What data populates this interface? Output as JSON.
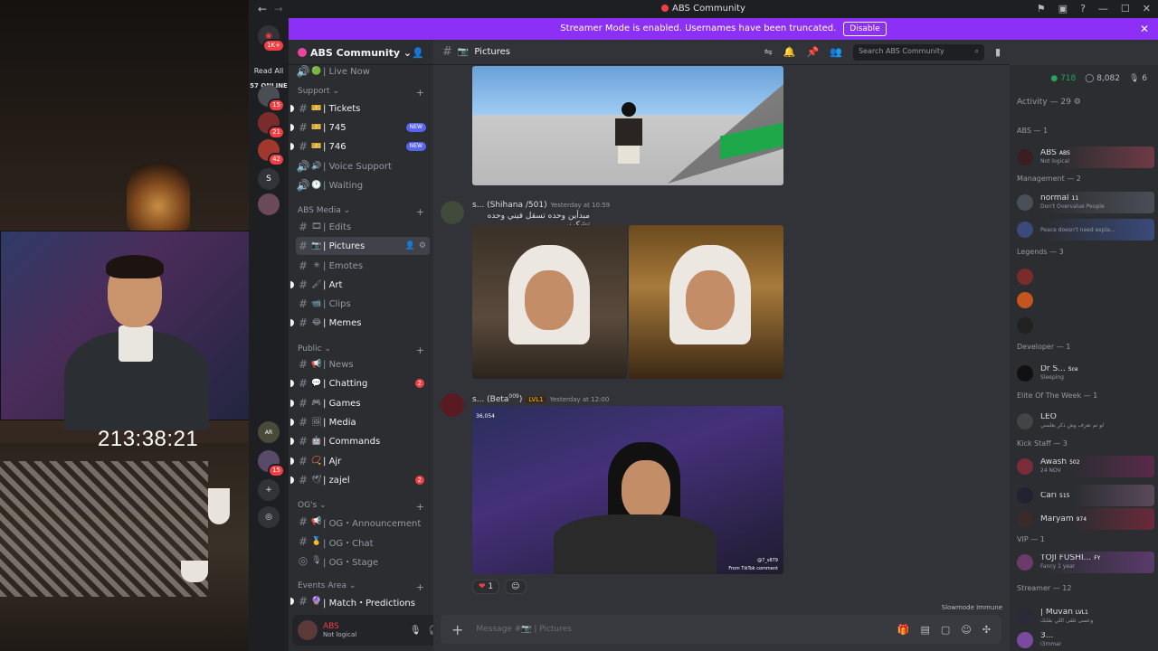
{
  "overlay": {
    "timer": "213:38:21"
  },
  "titlebar": {
    "title": "ABS Community",
    "back": "←",
    "forward": "→"
  },
  "guild_rail": {
    "read_all": "Read All",
    "online": "57 ONLINE",
    "badges": [
      "1K+",
      "15",
      "21",
      "42",
      "15"
    ],
    "server_letter": "S",
    "small_tag": "AR"
  },
  "banner": {
    "text": "Streamer Mode is enabled. Usernames have been truncated.",
    "button": "Disable",
    "close": "✕"
  },
  "server": {
    "name": "ABS Community"
  },
  "channels": [
    {
      "name": "Live Now",
      "emoji": "🟢",
      "type": "voice",
      "state": "normal"
    },
    {
      "category": "Support"
    },
    {
      "name": "Tickets",
      "emoji": "🎫",
      "type": "text",
      "state": "unread"
    },
    {
      "name": "745",
      "emoji": "🎫",
      "type": "text",
      "state": "unread",
      "badge": "NEW"
    },
    {
      "name": "746",
      "emoji": "🎫",
      "type": "text",
      "state": "unread",
      "badge": "NEW"
    },
    {
      "name": "Voice Support",
      "emoji": "🔊",
      "type": "voice",
      "state": "normal"
    },
    {
      "name": "Waiting",
      "emoji": "🕐",
      "type": "voice",
      "state": "normal"
    },
    {
      "category": "ABS Media"
    },
    {
      "name": "Edits",
      "emoji": "🎞",
      "type": "text",
      "state": "normal"
    },
    {
      "name": "Pictures",
      "emoji": "📷",
      "type": "text",
      "state": "active"
    },
    {
      "name": "Emotes",
      "emoji": "✳",
      "type": "text",
      "state": "normal"
    },
    {
      "name": "Art",
      "emoji": "🖌",
      "type": "text",
      "state": "unread"
    },
    {
      "name": "Clips",
      "emoji": "📹",
      "type": "text",
      "state": "normal"
    },
    {
      "name": "Memes",
      "emoji": "😂",
      "type": "text",
      "state": "unread"
    },
    {
      "category": "Public"
    },
    {
      "name": "News",
      "emoji": "📢",
      "type": "text",
      "state": "normal"
    },
    {
      "name": "Chatting",
      "emoji": "💬",
      "type": "text",
      "state": "unread",
      "count": "2"
    },
    {
      "name": "Games",
      "emoji": "🎮",
      "type": "text",
      "state": "unread"
    },
    {
      "name": "Media",
      "emoji": "🖼",
      "type": "text",
      "state": "unread"
    },
    {
      "name": "Commands",
      "emoji": "🤖",
      "type": "text",
      "state": "unread"
    },
    {
      "name": "Ajr",
      "emoji": "📿",
      "type": "text",
      "state": "unread"
    },
    {
      "name": "zajel",
      "emoji": "🕊",
      "type": "text",
      "state": "unread",
      "count": "2"
    },
    {
      "category": "OG's"
    },
    {
      "name": "OG・Announcement",
      "emoji": "📢",
      "type": "text",
      "state": "normal"
    },
    {
      "name": "OG・Chat",
      "emoji": "🥇",
      "type": "text",
      "state": "normal"
    },
    {
      "name": "OG・Stage",
      "emoji": "🎙",
      "type": "stage",
      "state": "normal"
    },
    {
      "category": "Events Area"
    },
    {
      "name": "Match・Predictions",
      "emoji": "🔮",
      "type": "text",
      "state": "unread"
    }
  ],
  "userbar": {
    "name": "ABS",
    "status": "Not logical"
  },
  "chat": {
    "channel": "Pictures",
    "search_placeholder": "Search ABS Community",
    "messages": [
      {
        "author": "s... (Shihana /501)",
        "time": "Yesterday at 10:59",
        "text": "مبدأين وحده تسقل فيني وحده تشكرني"
      },
      {
        "author": "s... (Beta",
        "author_sup": "009",
        "author_close": ")",
        "level": "LVL1",
        "time": "Yesterday at 12:00",
        "video_views": "36,054",
        "video_handle": "@7_s879",
        "video_footer": "From TikTok comment"
      }
    ],
    "reaction": {
      "emoji": "❤",
      "count": "1"
    },
    "composer_placeholder": "Message #📷 | Pictures",
    "slowmode": "Slowmode Immune"
  },
  "members": {
    "stats": {
      "online": "718",
      "total": "8,082",
      "voice": "6"
    },
    "activity_header": "Activity — 29",
    "groups": [
      {
        "title": "ABS — 1",
        "members": [
          {
            "name": "ABS",
            "tag": "ABS",
            "status": "Not logical"
          }
        ]
      },
      {
        "title": "Management — 2",
        "members": [
          {
            "name": "normal",
            "tag": "11",
            "status": "Don't Overvalue People"
          },
          {
            "name": "",
            "status": "Peace doesn't need expla..."
          }
        ]
      },
      {
        "title": "Legends — 3",
        "members": [
          {
            "name": ""
          },
          {
            "name": ""
          },
          {
            "name": ""
          }
        ]
      },
      {
        "title": "Developer — 1",
        "members": [
          {
            "name": "Dr S...",
            "tag": "Sce",
            "status": "Sleeping"
          }
        ]
      },
      {
        "title": "Elite Of The Week — 1",
        "members": [
          {
            "name": "LEO",
            "status": "لو تم تعرف وش ذكر يعلمني"
          }
        ]
      },
      {
        "title": "Kick Staff — 3",
        "members": [
          {
            "name": "Awash",
            "tag": "502",
            "status": "24 NOV"
          },
          {
            "name": "Cari",
            "tag": "515"
          },
          {
            "name": "Maryam",
            "tag": "974"
          }
        ]
      },
      {
        "title": "VIP — 1",
        "members": [
          {
            "name": "TOJI FUSHI...",
            "tag": "FY",
            "status": "Fancy 1 year"
          }
        ]
      },
      {
        "title": "Streamer — 12",
        "members": [
          {
            "name": "| Muvan",
            "tag": "LVL1",
            "status": "وعسى تلقى اللي بقلبك"
          },
          {
            "name": "3...",
            "status": "i3mmar"
          }
        ]
      }
    ]
  },
  "colors": {
    "accent": "#5865f2",
    "banner": "#8c30f5",
    "danger": "#f23f43",
    "online": "#23a55a"
  }
}
